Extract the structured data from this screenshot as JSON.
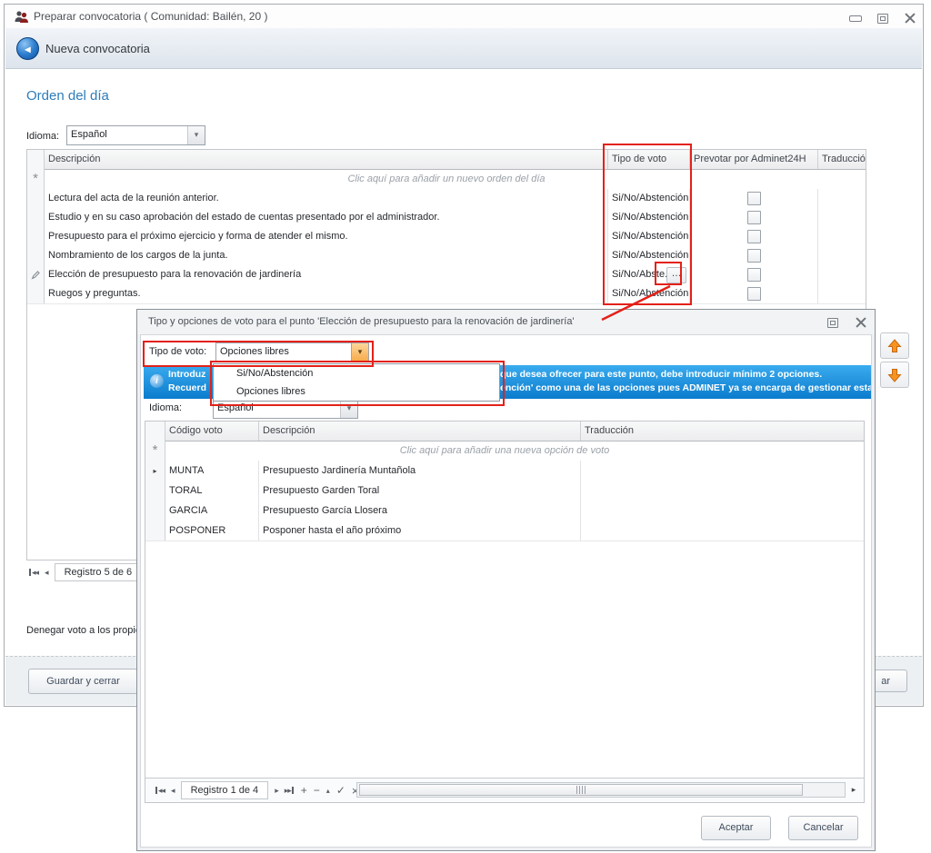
{
  "colors": {
    "annotation_red": "#e32119",
    "accent_blue": "#2b7cba",
    "info_bar_top": "#3aabee",
    "info_bar_bottom": "#0b7ccd",
    "orange_arrow": "#f79420"
  },
  "main_window": {
    "title": "Preparar convocatoria ( Comunidad: Bailén, 20 )",
    "header_title": "Nueva convocatoria",
    "section_title": "Orden del día",
    "idioma_label": "Idioma:",
    "idioma_value": "Español",
    "grid": {
      "col_descripcion": "Descripción",
      "col_tipo_voto": "Tipo de voto",
      "col_prevotar": "Prevotar por Adminet24H",
      "col_traduccion": "Traducción",
      "new_row_placeholder": "Clic aquí para añadir un nuevo orden del día",
      "ellipsis_button": "…",
      "rows": [
        {
          "descripcion": "Lectura del acta de la reunión anterior.",
          "tipo_voto": "Si/No/Abstención"
        },
        {
          "descripcion": "Estudio y en su caso aprobación del estado de cuentas presentado por el administrador.",
          "tipo_voto": "Si/No/Abstención"
        },
        {
          "descripcion": "Presupuesto para el próximo ejercicio y forma de atender el mismo.",
          "tipo_voto": "Si/No/Abstención"
        },
        {
          "descripcion": "Nombramiento de los cargos de la junta.",
          "tipo_voto": "Si/No/Abstención"
        },
        {
          "descripcion": "Elección de presupuesto para la renovación de jardinería",
          "tipo_voto": "Si/No/Abste..."
        },
        {
          "descripcion": "Ruegos y preguntas.",
          "tipo_voto": "Si/No/Abstención"
        }
      ]
    },
    "navigator_label": "Registro 5 de 6",
    "denegar_text": "Denegar voto a los propie",
    "save_close_button": "Guardar y cerrar",
    "right_button_fragment": "ar"
  },
  "modal": {
    "title": "Tipo y opciones de voto para el punto 'Elección de presupuesto para la renovación de jardinería'",
    "tipo_voto_label": "Tipo de voto:",
    "tipo_voto_value": "Opciones libres",
    "dropdown_options": [
      "Si/No/Abstención",
      "Opciones libres"
    ],
    "info_line1_left": "Introduz",
    "info_line1_right": "que desea ofrecer para este punto, debe introducir mínimo 2 opciones.",
    "info_line2_left": "Recuerd",
    "info_line2_right": "ención' como una de las opciones pues ADMINET ya se encarga de gestionar esta opción",
    "idioma_label": "Idioma:",
    "idioma_value": "Español",
    "grid": {
      "col_codigo": "Código voto",
      "col_descripcion": "Descripción",
      "col_traduccion": "Traducción",
      "new_row_placeholder": "Clic aquí para añadir una nueva opción de voto",
      "rows": [
        {
          "codigo": "MUNTA",
          "descripcion": "Presupuesto Jardinería Muntañola"
        },
        {
          "codigo": "TORAL",
          "descripcion": "Presupuesto Garden Toral"
        },
        {
          "codigo": "GARCIA",
          "descripcion": "Presupuesto García Llosera"
        },
        {
          "codigo": "POSPONER",
          "descripcion": "Posponer hasta el año próximo"
        }
      ]
    },
    "navigator_label": "Registro 1 de 4",
    "accept_button": "Aceptar",
    "cancel_button": "Cancelar"
  }
}
